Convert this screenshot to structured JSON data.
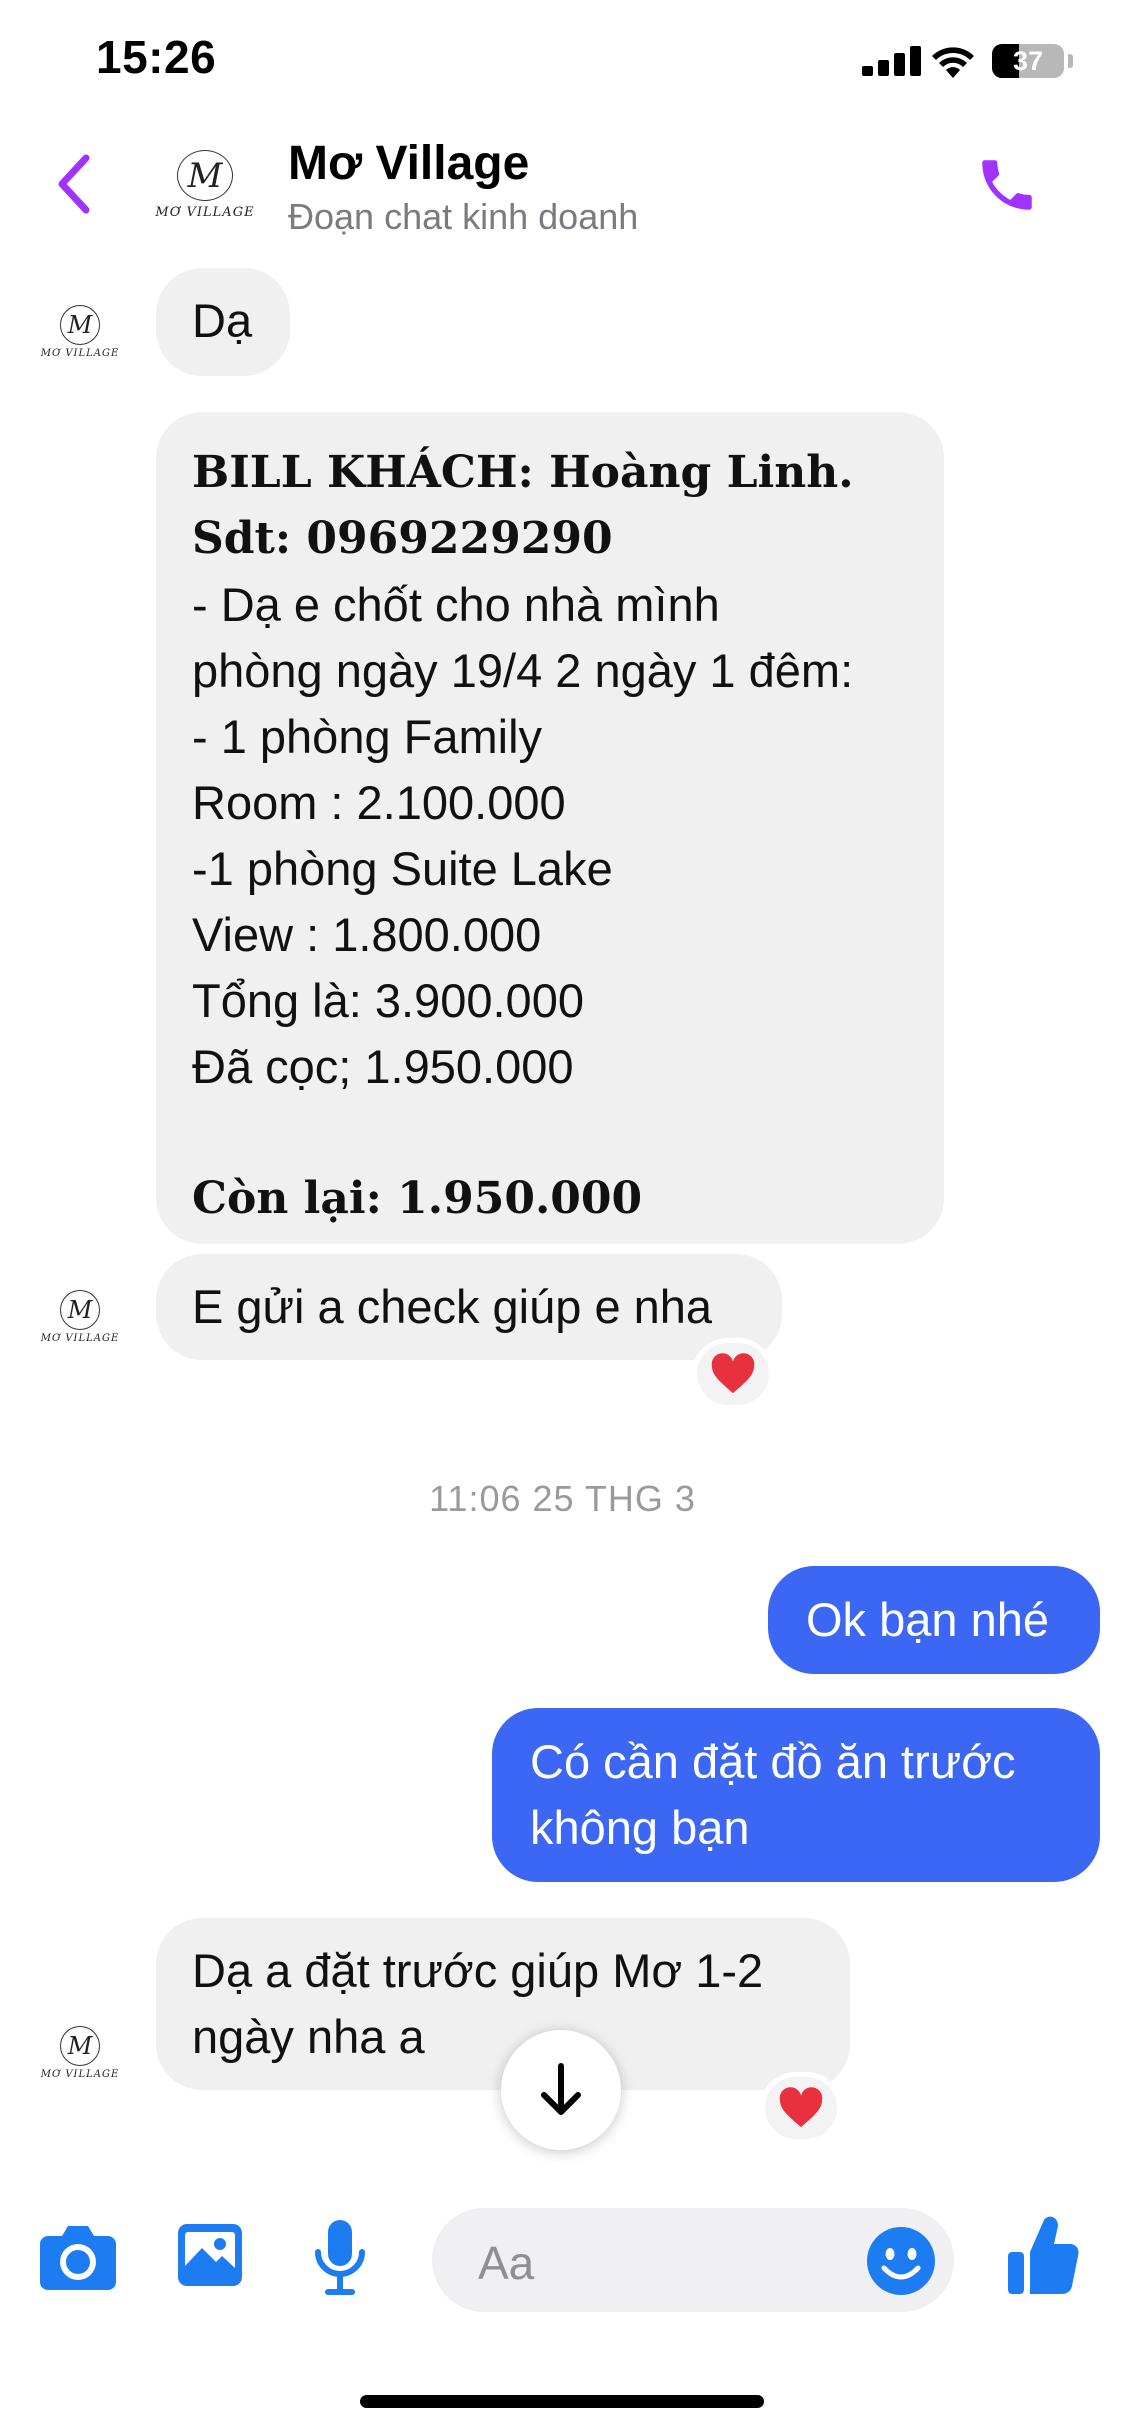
{
  "status_bar": {
    "time": "15:26",
    "battery": "37"
  },
  "header": {
    "title": "Mơ Village",
    "subtitle": "Đoạn chat kinh doanh",
    "back_icon": "chevron-left-icon",
    "call_icon": "phone-icon"
  },
  "logo": {
    "monogram": "M",
    "wordmark": "MƠ VILLAGE"
  },
  "messages": [
    {
      "from": "them",
      "text": "Dạ"
    },
    {
      "from": "them",
      "bold_lines": [
        "BILL KHÁCH: Hoàng Linh.",
        "Sdt: 0969229290"
      ],
      "lines": [
        "- Dạ e chốt cho nhà mình",
        "phòng ngày 19/4 2 ngày 1 đêm:",
        "- 1 phòng Family",
        "Room : 2.100.000",
        "-1 phòng Suite Lake",
        "View : 1.800.000",
        "Tổng là: 3.900.000",
        "Đã cọc; 1.950.000"
      ],
      "footer": "Còn lại: 1.950.000"
    },
    {
      "from": "them",
      "text": "E gửi a check giúp e nha",
      "reaction": "heart"
    },
    {
      "from": "me",
      "text": "Ok bạn nhé"
    },
    {
      "from": "me",
      "lines": [
        "Có cần đặt đồ ăn trước",
        "không bạn"
      ]
    },
    {
      "from": "them",
      "lines": [
        "Dạ a đặt trước giúp Mơ 1-2",
        "ngày nha a"
      ],
      "reaction": "heart"
    }
  ],
  "timestamp": "11:06 25 THG 3",
  "composer": {
    "placeholder": "Aa",
    "icons": [
      "camera-icon",
      "photo-icon",
      "microphone-icon",
      "emoji-icon",
      "thumbs-up-icon"
    ]
  },
  "colors": {
    "accent_purple": "#a033ff",
    "messenger_blue": "#3c67f5",
    "icon_blue": "#1e7cf2",
    "bubble_gray": "#f0f0f0"
  }
}
